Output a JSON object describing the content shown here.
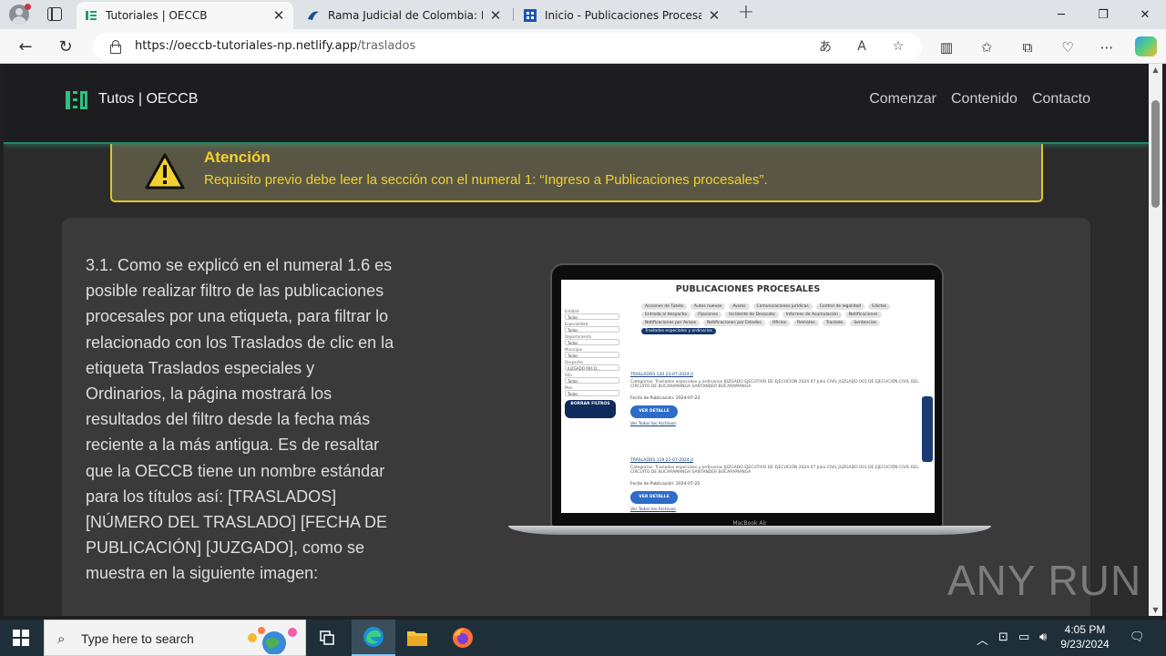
{
  "browser": {
    "tabs": [
      {
        "title": "Tutoriales | OECCB",
        "favicon": "doc-icon",
        "active": true
      },
      {
        "title": "Rama Judicial de Colombia: Infor",
        "favicon": "rama-icon",
        "active": false
      },
      {
        "title": "Inicio - Publicaciones Procesales",
        "favicon": "grid-icon",
        "active": false
      }
    ],
    "url_host": "https://oeccb-tutoriales-np.netlify.app",
    "url_path": "/traslados"
  },
  "site": {
    "brand": "Tutos | OECCB",
    "nav": [
      "Comenzar",
      "Contenido",
      "Contacto"
    ],
    "accent": "#2ec27e"
  },
  "alert": {
    "title": "Atención",
    "text": "Requisito previo debe leer la sección con el numeral 1: “Ingreso a Publicaciones procesales”.",
    "color": "#f2d12e"
  },
  "content": {
    "paragraph": "3.1. Como se explicó en el numeral 1.6 es posible realizar filtro de las publicaciones procesales por una etiqueta, para filtrar lo relacionado con los Traslados de clic en la etiqueta Traslados especiales y Ordinarios, la página mostrará los resultados del filtro desde la fecha más reciente a la más antigua. Es de resaltar que la OECCB tiene un nombre estándar para los títulos así: [TRASLADOS] [NÚMERO DEL TRASLADO] [FECHA DE PUBLICACIÓN] [JUZGADO], como se muestra en la siguiente imagen:"
  },
  "laptop": {
    "screen_title": "PUBLICACIONES PROCESALES",
    "model_label": "MacBook Air",
    "filters": [
      {
        "label": "Entidad",
        "value": "Todos"
      },
      {
        "label": "Especialidad",
        "value": "Todos"
      },
      {
        "label": "Departamento",
        "value": "Todos"
      },
      {
        "label": "Municipio",
        "value": "Todos"
      },
      {
        "label": "Despacho",
        "value": "JUZGADO 004 D..."
      },
      {
        "label": "Año",
        "value": "Todos"
      },
      {
        "label": "Mes",
        "value": "Todos"
      }
    ],
    "clear_button": "BORRAR FILTROS",
    "tags": [
      "Acciones de Tutela",
      "Autos nuevos",
      "Avisos",
      "Comunicaciones jurídicas",
      "Control de legalidad",
      "Edictos",
      "Entrada al despacho",
      "Fijaciones",
      "Incidente de Desacato",
      "Informes de Acumulación",
      "Notificaciones",
      "Notificaciones por Avisos",
      "Notificaciones por Estados",
      "Oficios",
      "Remates",
      "Traslado",
      "Sentencias",
      "Traslados especiales y ordinarios"
    ],
    "results": [
      {
        "title": "TRASLADOS 120 23-07-2024 JI",
        "categories": "Categorías:  Traslados especiales y ordinarios   JUZGADO EJECUTIVO DE EJECUCIÓN   2024   07 Julio   CIVIL   JUZGADO 001 DE EJECUCIÓN CIVIL DEL CIRCUITO DE BUCARAMANGA   SANTANDER   BUCARAMANGA",
        "date": "Fecha de Publicación: 2024-07-23",
        "button": "VER DETALLE",
        "all": "Ver Todos los Archivos"
      },
      {
        "title": "TRASLADOS 119 22-07-2024 JI",
        "categories": "Categorías:  Traslados especiales y ordinarios   JUZGADO EJECUTIVO DE EJECUCIÓN   2024   07 Julio   CIVIL   JUZGADO 001 DE EJECUCIÓN CIVIL DEL CIRCUITO DE BUCARAMANGA   SANTANDER   BUCARAMANGA",
        "date": "Fecha de Publicación: 2024-07-22",
        "button": "VER DETALLE",
        "all": "Ver Todos los Archivos"
      }
    ]
  },
  "watermark": "ANY RUN",
  "taskbar": {
    "search_placeholder": "Type here to search",
    "time": "4:05 PM",
    "date": "9/23/2024"
  }
}
